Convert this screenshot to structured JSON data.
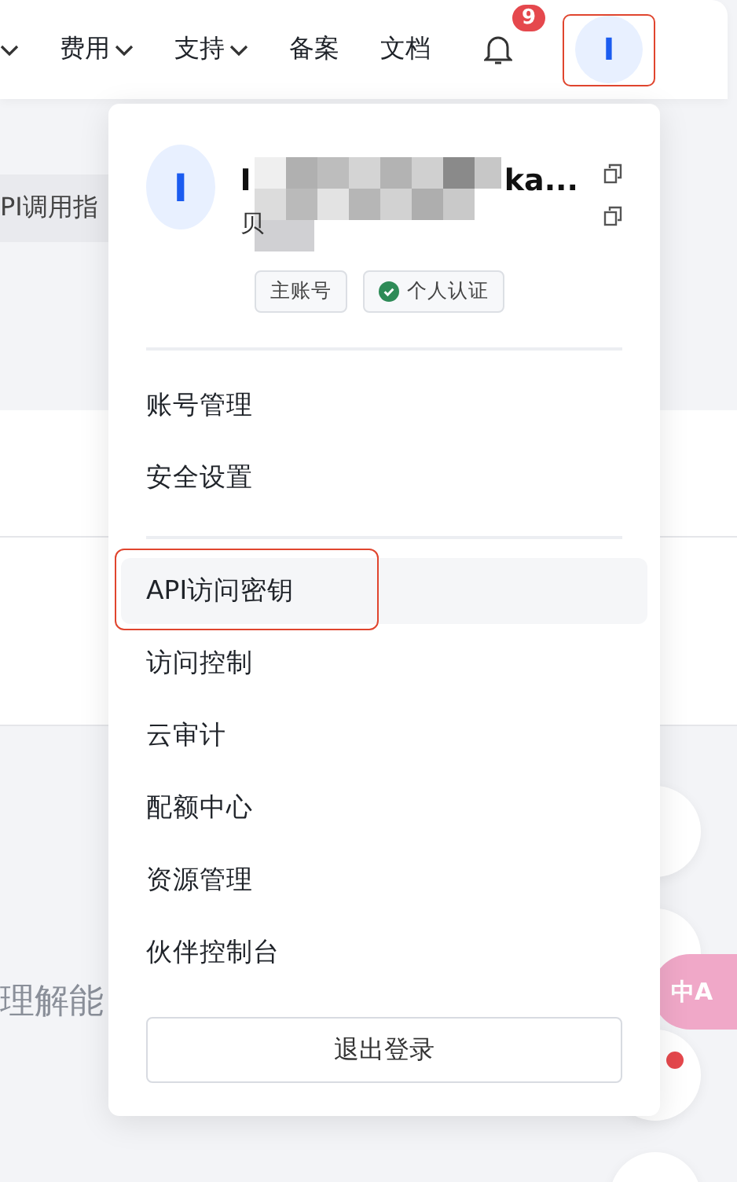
{
  "navbar": {
    "items": [
      {
        "dropdown": true
      },
      {
        "label": "费用",
        "dropdown": true
      },
      {
        "label": "支持",
        "dropdown": true
      },
      {
        "label": "备案",
        "dropdown": false
      },
      {
        "label": "文档",
        "dropdown": false
      }
    ],
    "notifications": {
      "count": "9"
    },
    "avatar": {
      "initial": "I",
      "annotated": true
    }
  },
  "page": {
    "tab_label": "PI调用指",
    "text_fragment": "理解能"
  },
  "account_menu": {
    "avatar_initial": "I",
    "name_start": "I",
    "name_end": "ka...",
    "id_start": "贝",
    "tags": [
      {
        "label": "主账号",
        "verified": false
      },
      {
        "label": "个人认证",
        "verified": true
      }
    ],
    "groups": [
      [
        {
          "label": "账号管理",
          "selected": false,
          "annotated": false
        },
        {
          "label": "安全设置",
          "selected": false,
          "annotated": false
        }
      ],
      [
        {
          "label": "API访问密钥",
          "selected": true,
          "annotated": true
        },
        {
          "label": "访问控制",
          "selected": false,
          "annotated": false
        },
        {
          "label": "云审计",
          "selected": false,
          "annotated": false
        },
        {
          "label": "配额中心",
          "selected": false,
          "annotated": false
        },
        {
          "label": "资源管理",
          "selected": false,
          "annotated": false
        },
        {
          "label": "伙伴控制台",
          "selected": false,
          "annotated": false
        }
      ]
    ],
    "logout": "退出登录"
  },
  "translate_bubble": {
    "label": "中A"
  }
}
